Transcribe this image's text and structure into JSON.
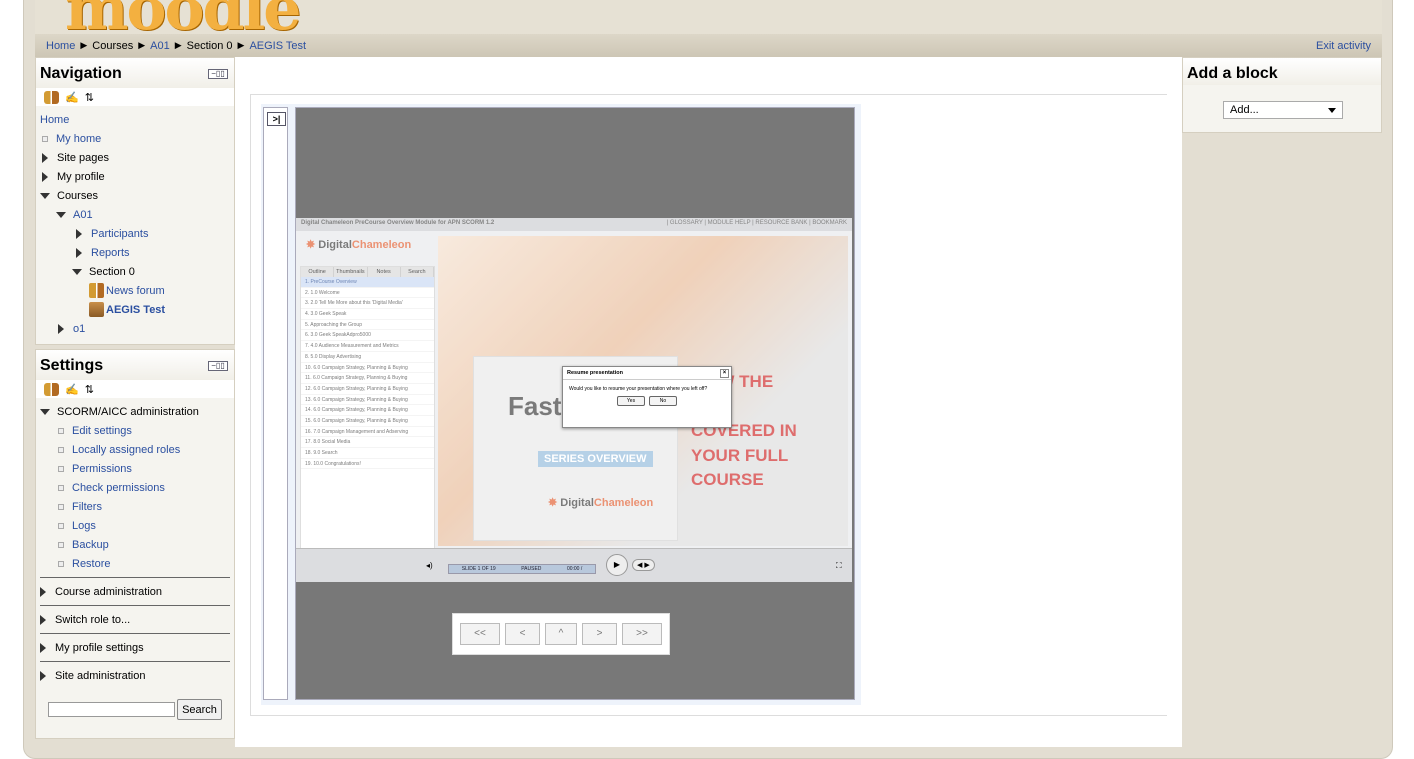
{
  "breadcrumb": {
    "home": "Home",
    "courses": "Courses",
    "a01": "A01",
    "section": "Section 0",
    "current": "AEGIS Test"
  },
  "header": {
    "logo_text": "moodle",
    "exit_label": "Exit activity"
  },
  "navigation": {
    "title": "Navigation",
    "home": "Home",
    "items": {
      "my_home": "My home",
      "site_pages": "Site pages",
      "my_profile": "My profile",
      "courses": "Courses",
      "a01": "A01",
      "participants": "Participants",
      "reports": "Reports",
      "section0": "Section 0",
      "news_forum": "News forum",
      "aegis_test": "AEGIS Test",
      "o1": "o1"
    }
  },
  "settings": {
    "title": "Settings",
    "scorm_admin": "SCORM/AICC administration",
    "items": [
      "Edit settings",
      "Locally assigned roles",
      "Permissions",
      "Check permissions",
      "Filters",
      "Logs",
      "Backup",
      "Restore"
    ],
    "course_admin": "Course administration",
    "switch_role": "Switch role to...",
    "profile_settings": "My profile settings",
    "site_admin": "Site administration",
    "search_button": "Search",
    "search_value": ""
  },
  "addblock": {
    "title": "Add a block",
    "select_value": "Add..."
  },
  "scorm": {
    "toc_toggle": ">|",
    "slide_header": "Digital Chameleon PreCourse Overview Module for APN SCORM 1.2",
    "slide_links": "| GLOSSARY | MODULE HELP | RESOURCE BANK | BOOKMARK",
    "brand_a": "Digital",
    "brand_b": "Chameleon",
    "tabs": [
      "Outline",
      "Thumbnails",
      "Notes",
      "Search"
    ],
    "outline": [
      "1. PreCourse Overview",
      "2. 1.0 Welcome",
      "3. 2.0 Tell Me More about this 'Digital Media'",
      "4. 3.0 Geek Speak",
      "5. Approaching the Group",
      "6. 3.0 Geek SpeakAdpro5000",
      "7. 4.0 Audience Measurement and Metrics",
      "8. 5.0 Display Advertising",
      "10. 6.0 Campaign Strategy, Planning & Buying",
      "11. 6.0 Campaign Strategy, Planning & Buying",
      "12. 6.0 Campaign Strategy, Planning & Buying",
      "13. 6.0 Campaign Strategy, Planning & Buying",
      "14. 6.0 Campaign Strategy, Planning & Buying",
      "15. 6.0 Campaign Strategy, Planning & Buying",
      "16. 7.0 Campaign Management and Adserving",
      "17. 8.0 Social Media",
      "18. 9.0 Search",
      "19. 10.0 Congratulations!"
    ],
    "box_title": "Fast",
    "box_sub": "SERIES OVERVIEW",
    "red_lines": [
      "VIEW THE",
      "ICS",
      "COVERED IN",
      "YOUR FULL",
      "COURSE"
    ],
    "progress": [
      "SLIDE 1 OF 19",
      "PAUSED",
      "00:00 /"
    ],
    "dialog": {
      "title": "Resume presentation",
      "body": "Would you like to resume your presentation where you left off?",
      "yes": "Yes",
      "no": "No",
      "close": "×"
    },
    "nav": [
      "<<",
      "<",
      "^",
      ">",
      ">>"
    ]
  }
}
